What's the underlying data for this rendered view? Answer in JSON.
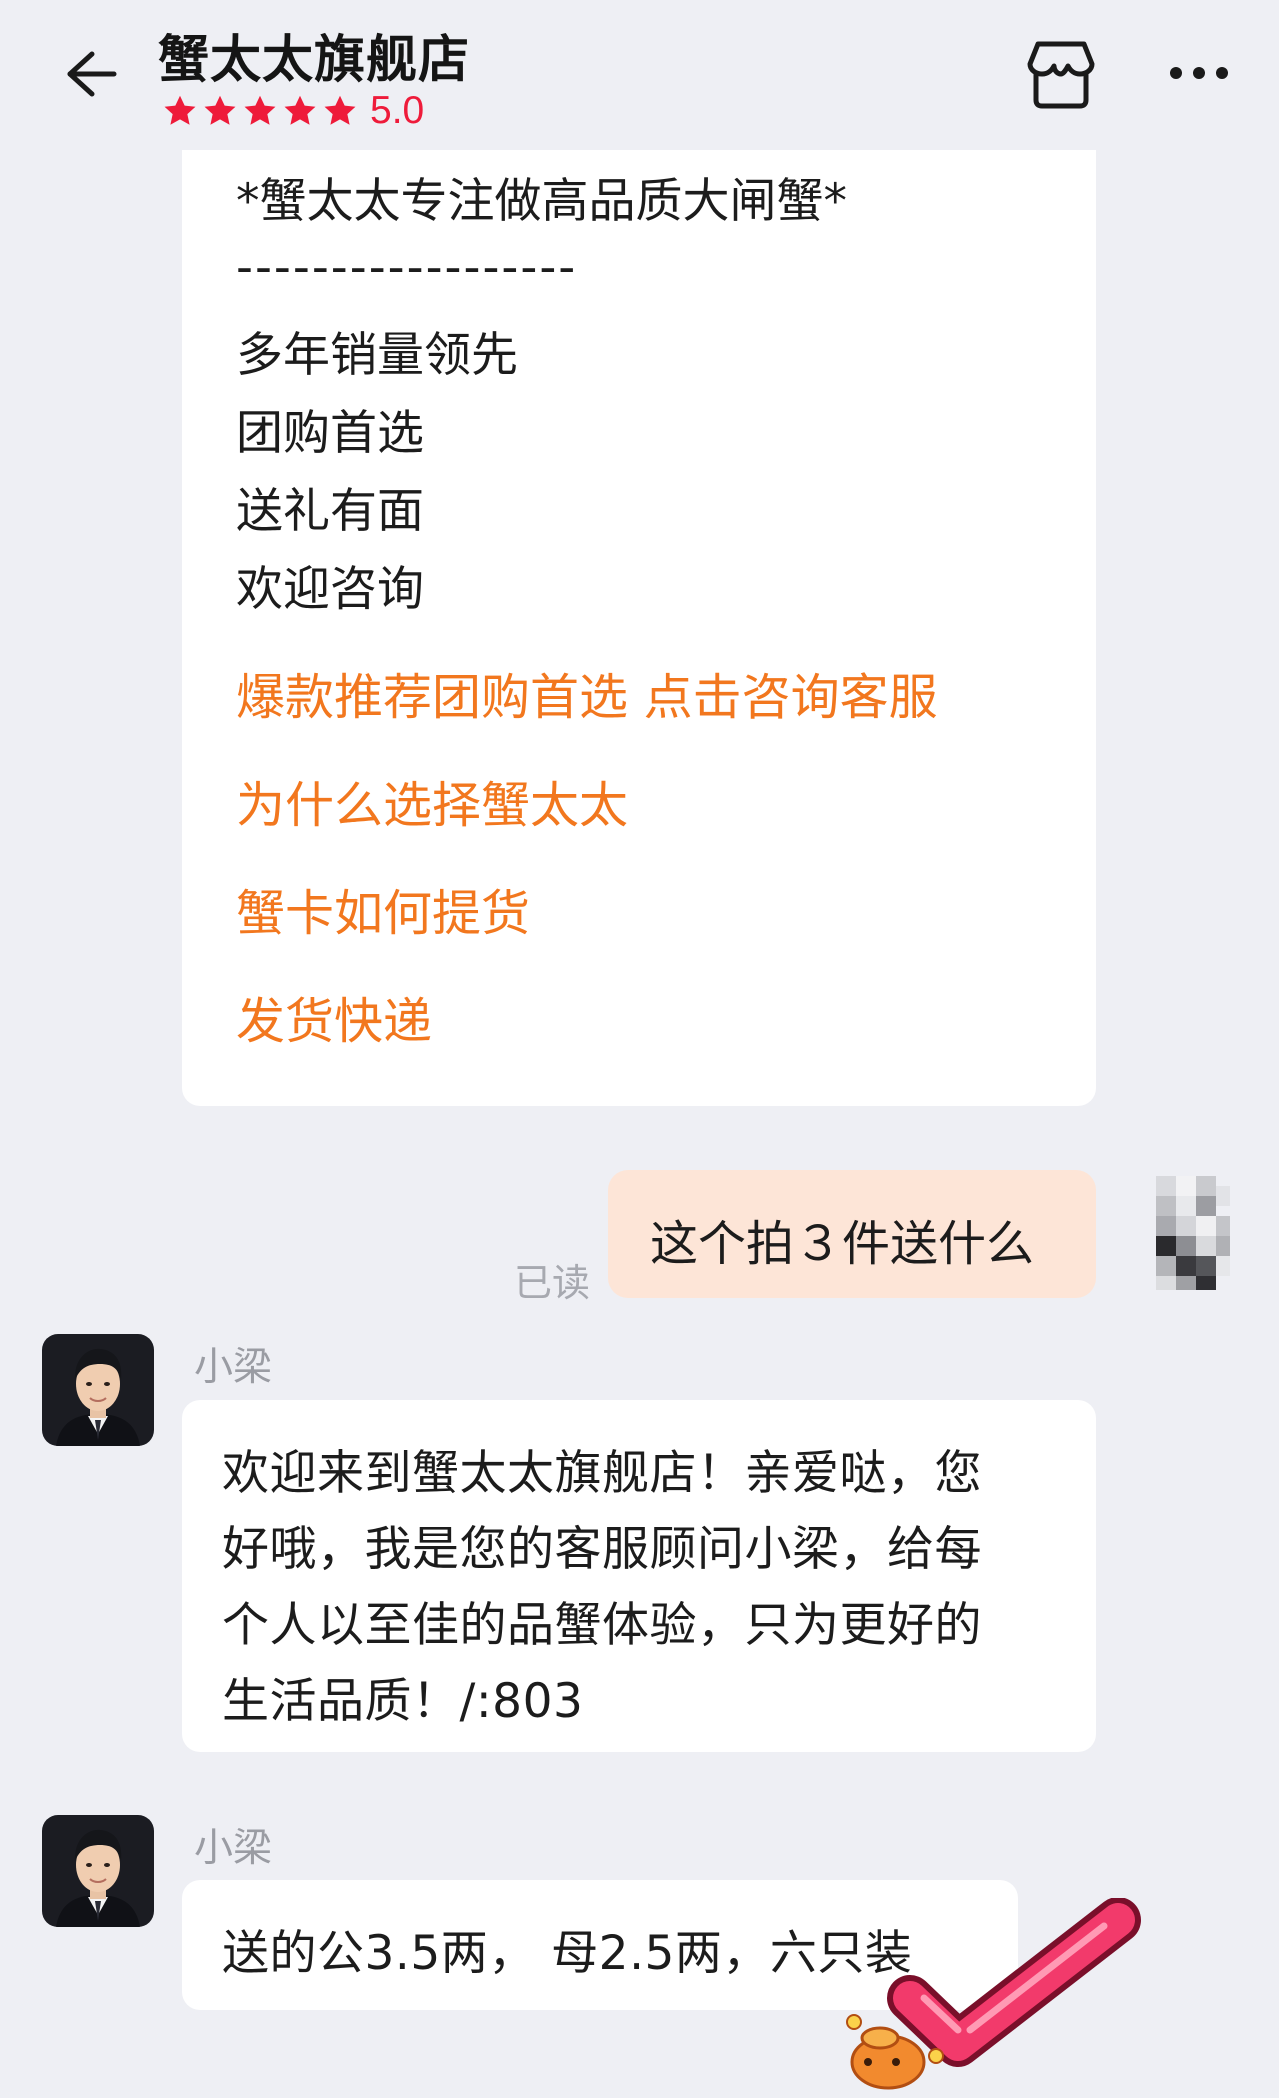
{
  "header": {
    "back_icon": "arrow-left-icon",
    "shop_name": "蟹太太旗舰店",
    "rating_stars": 5,
    "rating_score": "5.0",
    "store_icon": "store-icon",
    "more_icon": "more-dots-icon"
  },
  "menu_card": {
    "tagline": "*蟹太太专注做高品质大闸蟹*",
    "divider": "------------------",
    "lines": [
      "多年销量领先",
      "团购首选",
      "送礼有面",
      "欢迎咨询"
    ],
    "links": [
      "爆款推荐团购首选 点击咨询客服",
      "为什么选择蟹太太",
      "蟹卡如何提货",
      "发货快递"
    ]
  },
  "user_message": {
    "text": "这个拍３件送什么",
    "read_status": "已读"
  },
  "agent_messages": [
    {
      "name": "小梁",
      "lines": [
        "欢迎来到蟹太太旗舰店！亲爱哒，您",
        "好哦，我是您的客服顾问小梁，给每",
        "个人以至佳的品蟹体验，只为更好的",
        "生活品质！/:803"
      ]
    },
    {
      "name": "小梁",
      "lines": [
        "送的公3.5两， 母2.5两，六只装"
      ]
    }
  ],
  "colors": {
    "background": "#eeeff4",
    "accent_orange": "#f2771e",
    "rating_red": "#ee1b3a",
    "user_bubble": "#fde5d7",
    "check_pink": "#f23a6b"
  },
  "sticker_icon": "check-mark-sticker-icon"
}
